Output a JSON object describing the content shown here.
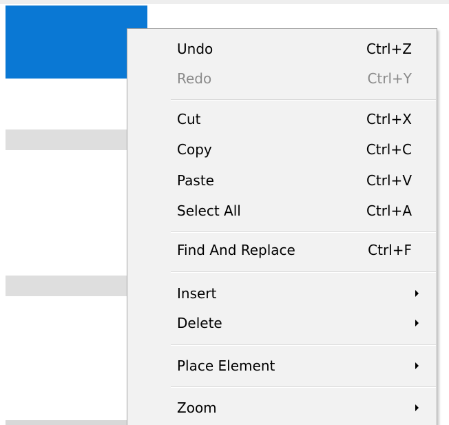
{
  "background": {
    "selection_color": "#0a78d4",
    "row_shade_color": "#dedede"
  },
  "context_menu": {
    "background": "#f2f2f2",
    "border": "#a0a0a0",
    "items": [
      {
        "label": "Undo",
        "shortcut": "Ctrl+Z",
        "enabled": true
      },
      {
        "label": "Redo",
        "shortcut": "Ctrl+Y",
        "enabled": false
      },
      {
        "separator": true
      },
      {
        "label": "Cut",
        "shortcut": "Ctrl+X",
        "enabled": true
      },
      {
        "label": "Copy",
        "shortcut": "Ctrl+C",
        "enabled": true
      },
      {
        "label": "Paste",
        "shortcut": "Ctrl+V",
        "enabled": true
      },
      {
        "label": "Select All",
        "shortcut": "Ctrl+A",
        "enabled": true
      },
      {
        "separator": true
      },
      {
        "label": "Find And Replace",
        "shortcut": "Ctrl+F",
        "enabled": true
      },
      {
        "separator": true
      },
      {
        "label": "Insert",
        "submenu": true,
        "enabled": true,
        "icon": "chevron-right-icon"
      },
      {
        "label": "Delete",
        "submenu": true,
        "enabled": true,
        "icon": "chevron-right-icon"
      },
      {
        "separator": true
      },
      {
        "label": "Place Element",
        "submenu": true,
        "enabled": true,
        "icon": "chevron-right-icon"
      },
      {
        "separator": true
      },
      {
        "label": "Zoom",
        "submenu": true,
        "enabled": true,
        "icon": "chevron-right-icon"
      }
    ]
  }
}
